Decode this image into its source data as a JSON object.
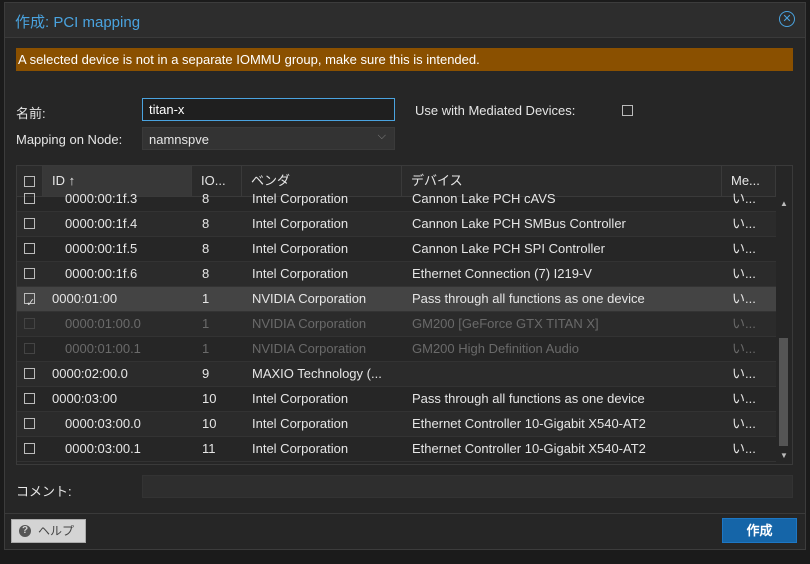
{
  "dialog": {
    "title": "作成: PCI mapping",
    "warning": "A selected device is not in a separate IOMMU group, make sure this is intended."
  },
  "form": {
    "name_label": "名前:",
    "name_value": "titan-x",
    "mediated_label": "Use with Mediated Devices:",
    "mediated_checked": false,
    "node_label": "Mapping on Node:",
    "node_value": "namnspve",
    "comment_label": "コメント:",
    "comment_value": ""
  },
  "grid": {
    "columns": [
      "ID ↑",
      "IO...",
      "ベンダ",
      "デバイス",
      "Me..."
    ],
    "rows": [
      {
        "id": "0000:00:1f.3",
        "iommu": "8",
        "vendor": "Intel Corporation",
        "device": "Cannon Lake PCH cAVS",
        "mdev": "い...",
        "checked": false,
        "sub": true,
        "disabled": false
      },
      {
        "id": "0000:00:1f.4",
        "iommu": "8",
        "vendor": "Intel Corporation",
        "device": "Cannon Lake PCH SMBus Controller",
        "mdev": "い...",
        "checked": false,
        "sub": true,
        "disabled": false
      },
      {
        "id": "0000:00:1f.5",
        "iommu": "8",
        "vendor": "Intel Corporation",
        "device": "Cannon Lake PCH SPI Controller",
        "mdev": "い...",
        "checked": false,
        "sub": true,
        "disabled": false
      },
      {
        "id": "0000:00:1f.6",
        "iommu": "8",
        "vendor": "Intel Corporation",
        "device": "Ethernet Connection (7) I219-V",
        "mdev": "い...",
        "checked": false,
        "sub": true,
        "disabled": false
      },
      {
        "id": "0000:01:00",
        "iommu": "1",
        "vendor": "NVIDIA Corporation",
        "device": "Pass through all functions as one device",
        "mdev": "い...",
        "checked": true,
        "sub": false,
        "disabled": false
      },
      {
        "id": "0000:01:00.0",
        "iommu": "1",
        "vendor": "NVIDIA Corporation",
        "device": "GM200 [GeForce GTX TITAN X]",
        "mdev": "い...",
        "checked": false,
        "sub": true,
        "disabled": true
      },
      {
        "id": "0000:01:00.1",
        "iommu": "1",
        "vendor": "NVIDIA Corporation",
        "device": "GM200 High Definition Audio",
        "mdev": "い...",
        "checked": false,
        "sub": true,
        "disabled": true
      },
      {
        "id": "0000:02:00.0",
        "iommu": "9",
        "vendor": "MAXIO Technology (...",
        "device": "",
        "mdev": "い...",
        "checked": false,
        "sub": false,
        "disabled": false
      },
      {
        "id": "0000:03:00",
        "iommu": "10",
        "vendor": "Intel Corporation",
        "device": "Pass through all functions as one device",
        "mdev": "い...",
        "checked": false,
        "sub": false,
        "disabled": false
      },
      {
        "id": "0000:03:00.0",
        "iommu": "10",
        "vendor": "Intel Corporation",
        "device": "Ethernet Controller 10-Gigabit X540-AT2",
        "mdev": "い...",
        "checked": false,
        "sub": true,
        "disabled": false
      },
      {
        "id": "0000:03:00.1",
        "iommu": "11",
        "vendor": "Intel Corporation",
        "device": "Ethernet Controller 10-Gigabit X540-AT2",
        "mdev": "い...",
        "checked": false,
        "sub": true,
        "disabled": false
      }
    ]
  },
  "footer": {
    "help_label": "ヘルプ",
    "create_label": "作成"
  },
  "icons": {
    "close": "close-icon",
    "help": "help-icon",
    "dropdown": "chevron-down-icon"
  },
  "colors": {
    "accent": "#4aa3df",
    "warning_bg": "#8a5000",
    "primary_button": "#1565a8"
  }
}
